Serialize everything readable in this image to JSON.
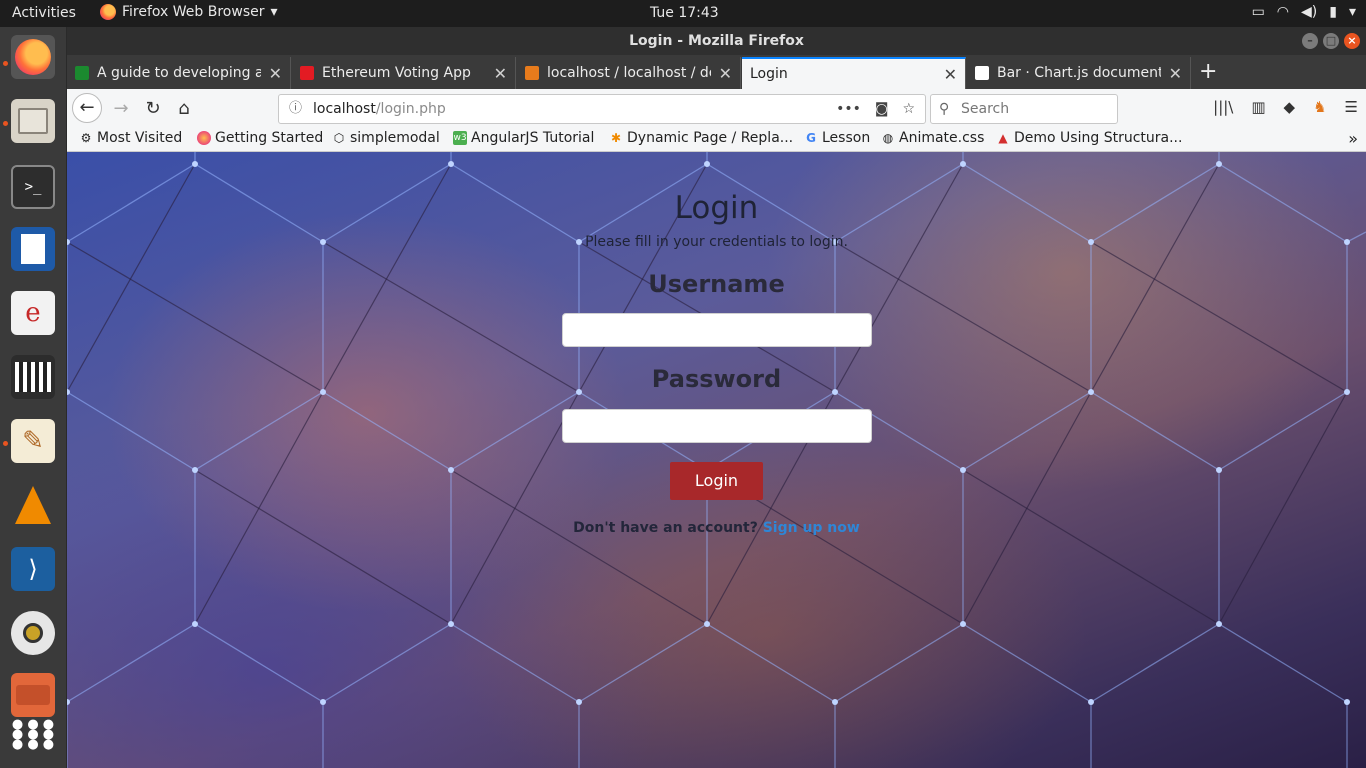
{
  "system": {
    "activities": "Activities",
    "app_menu": "Firefox Web Browser",
    "clock": "Tue 17:43"
  },
  "window": {
    "title": "Login - Mozilla Firefox"
  },
  "tabs": [
    {
      "label": "A guide to developing an",
      "favicon_color": "#1b8a2f"
    },
    {
      "label": "Ethereum Voting App",
      "favicon_color": "#e31b23"
    },
    {
      "label": "localhost / localhost / de",
      "favicon_color": "#e77b1c"
    },
    {
      "label": "Login",
      "favicon_color": "#f5f6f7"
    },
    {
      "label": "Bar · Chart.js documenta",
      "favicon_color": "#ffffff"
    }
  ],
  "navbar": {
    "url_host": "localhost",
    "url_path": "/login.php",
    "search_placeholder": "Search"
  },
  "bookmarks": [
    {
      "label": "Most Visited",
      "icon": "gear-icon"
    },
    {
      "label": "Getting Started",
      "icon": "firefox-icon"
    },
    {
      "label": "simplemodal",
      "icon": "cube-icon"
    },
    {
      "label": "AngularJS Tutorial",
      "icon": "w3-icon"
    },
    {
      "label": "Dynamic Page / Repla...",
      "icon": "asterisk-icon"
    },
    {
      "label": "Lesson",
      "icon": "google-icon"
    },
    {
      "label": "Animate.css",
      "icon": "globe-icon"
    },
    {
      "label": "Demo Using Structura...",
      "icon": "triangle-icon"
    }
  ],
  "login": {
    "title": "Login",
    "subtitle": "Please fill in your credentials to login.",
    "username_label": "Username",
    "username_value": "",
    "password_label": "Password",
    "password_value": "",
    "button_label": "Login",
    "signup_prompt": "Don't have an account?",
    "signup_link": "Sign up now"
  },
  "colors": {
    "accent_button": "#a8282a",
    "link": "#2f86d6",
    "ubuntu_orange": "#e95420"
  }
}
